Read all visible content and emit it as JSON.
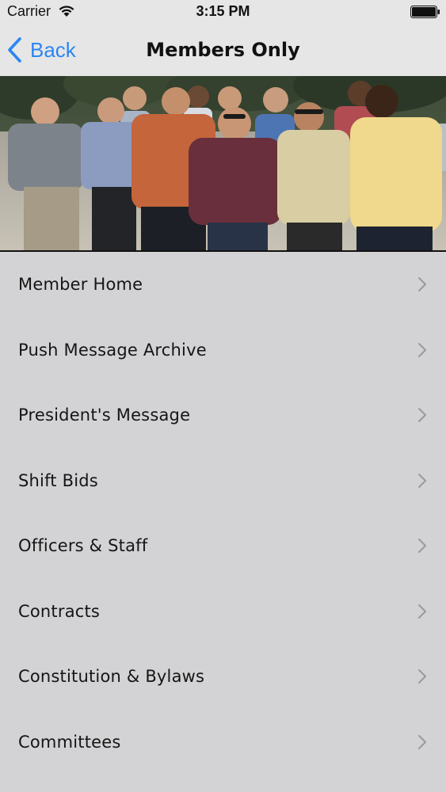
{
  "status_bar": {
    "carrier": "Carrier",
    "time": "3:15 PM"
  },
  "nav": {
    "back_label": "Back",
    "title": "Members Only",
    "accent_color": "#2b86f2"
  },
  "hero": {
    "description_icon": "group-photo"
  },
  "menu": {
    "items": [
      {
        "label": "Member Home"
      },
      {
        "label": "Push Message Archive"
      },
      {
        "label": "President's Message"
      },
      {
        "label": "Shift Bids"
      },
      {
        "label": "Officers & Staff"
      },
      {
        "label": "Contracts"
      },
      {
        "label": "Constitution & Bylaws"
      },
      {
        "label": "Committees"
      }
    ]
  }
}
